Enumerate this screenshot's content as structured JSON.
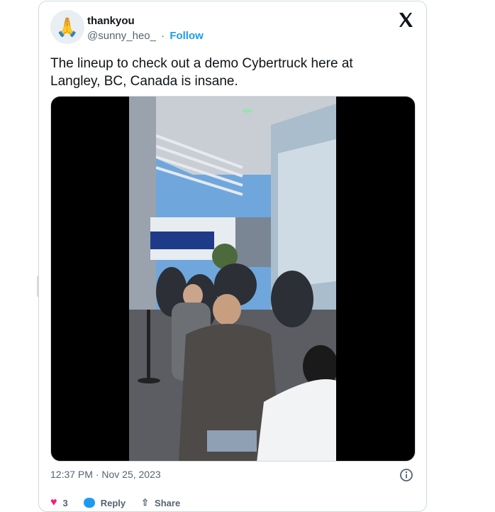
{
  "user": {
    "name": "thankyou",
    "handle": "@sunny_heo_",
    "separator": "·",
    "follow_label": "Follow",
    "avatar_emoji": "🙏"
  },
  "tweet": {
    "text": "The lineup to check out a demo Cybertruck here at Langley, BC, Canada is insane.",
    "timestamp": "12:37 PM · Nov 25, 2023"
  },
  "actions": {
    "likes": "3",
    "reply_label": "Reply",
    "share_label": "Share"
  },
  "icons": [
    "x-logo-icon",
    "info-icon",
    "heart-icon",
    "reply-icon",
    "share-icon"
  ],
  "colors": {
    "accent": "#1d9bf0",
    "like": "#f91880",
    "secondary_text": "#536471"
  }
}
